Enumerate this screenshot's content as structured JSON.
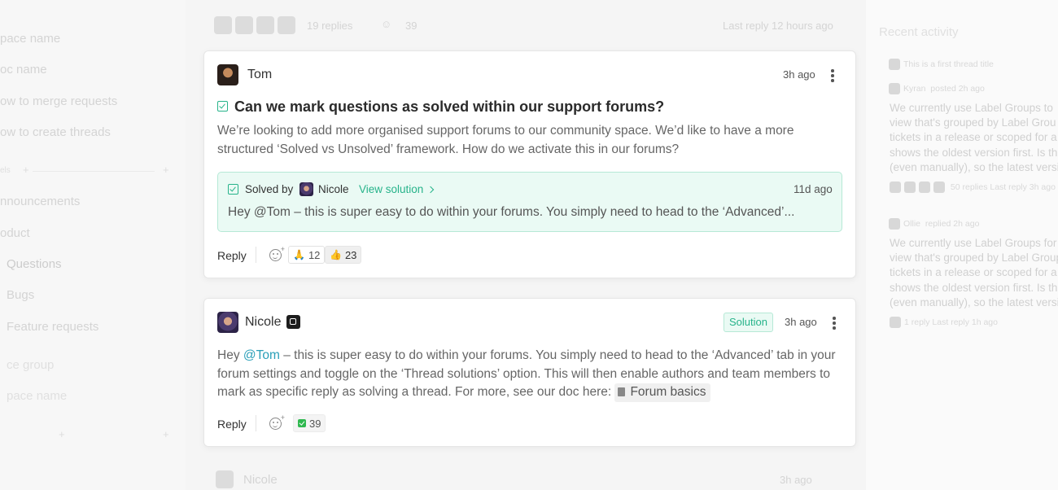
{
  "sidebar": {
    "items": [
      {
        "label": "pace name"
      },
      {
        "label": "oc name"
      },
      {
        "label": "ow to merge requests"
      },
      {
        "label": "ow to create threads"
      },
      {
        "label": "nnouncements"
      },
      {
        "label": "oduct"
      },
      {
        "label": "Questions"
      },
      {
        "label": "Bugs"
      },
      {
        "label": "Feature requests"
      },
      {
        "label": "ce group"
      },
      {
        "label": "pace name"
      }
    ],
    "section_label": "els"
  },
  "top_thread": {
    "replies": "19 replies",
    "reaction_count": "39",
    "last_reply": "Last reply 12 hours ago"
  },
  "post": {
    "author": "Tom",
    "time": "3h ago",
    "title": "Can we mark questions as solved within our support forums?",
    "body": "We’re looking to add more organised support forums to our community space. We’d like to have a more structured ‘Solved vs Unsolved’ framework. How do we activate this in our forums?",
    "solution": {
      "solved_by_label": "Solved by",
      "solver": "Nicole",
      "view_link": "View solution",
      "time": "11d ago",
      "preview": "Hey @Tom – this is super easy to do within your forums. You simply need to head to the ‘Advanced’..."
    },
    "reply_label": "Reply",
    "reactions": [
      {
        "emoji": "🙏",
        "count": "12"
      },
      {
        "emoji": "👍",
        "count": "23"
      }
    ]
  },
  "reply_post": {
    "author": "Nicole",
    "badge": "Solution",
    "time": "3h ago",
    "body_prefix": "Hey ",
    "mention": "@Tom",
    "body_main": " – this is super easy to do within your forums. You simply need to head to the ‘Advanced’ tab in your forum settings and toggle on the ‘Thread solutions’ option. This will then enable authors and team members to mark as specific reply as solving a thread. For more, see our doc here: ",
    "doc_link": "Forum basics",
    "reply_label": "Reply",
    "reactions": [
      {
        "emoji": "check",
        "count": "39"
      }
    ]
  },
  "bottom_ghost": {
    "author": "Nicole",
    "time": "3h ago"
  },
  "activity": {
    "title": "Recent activity",
    "thread_title": "This is a first thread title",
    "entries": [
      {
        "user": "Kyran",
        "action": "posted 2h ago",
        "lines": [
          "We currently use Label Groups to",
          "view that's grouped by Label Grou",
          "tickets in a release or scoped for a",
          "shows the oldest version first. Is th",
          "(even manually), so the latest versi"
        ],
        "meta": "50 replies   Last reply 3h ago"
      },
      {
        "user": "Ollie",
        "action": "replied 2h ago",
        "lines": [
          "We currently use Label Groups for",
          "view that's grouped by Label Group",
          "tickets in a release or scoped for a",
          "shows the oldest version first. Is th",
          "(even manually), so the latest versi"
        ],
        "meta": "1 reply   Last reply 1h ago"
      }
    ]
  }
}
